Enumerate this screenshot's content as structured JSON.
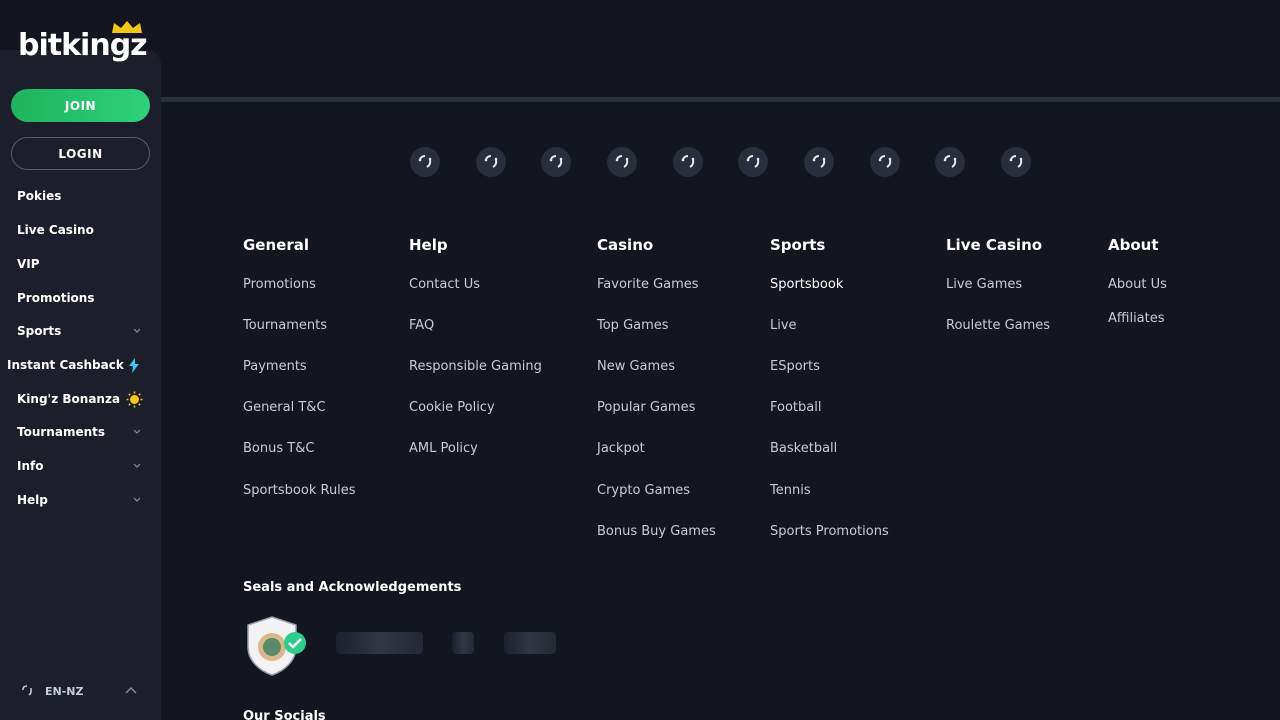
{
  "brand": {
    "logo_text": "bitkingz"
  },
  "sidebar": {
    "join_label": "JOIN",
    "login_label": "LOGIN",
    "items": [
      {
        "label": "Pokies",
        "has_chevron": false
      },
      {
        "label": "Live Casino",
        "has_chevron": false
      },
      {
        "label": "VIP",
        "has_chevron": false
      },
      {
        "label": "Promotions",
        "has_chevron": false
      },
      {
        "label": "Sports",
        "has_chevron": true
      },
      {
        "label": "Instant Cashback",
        "icon": "lightning-icon"
      },
      {
        "label": "King'z Bonanza",
        "icon": "sun-icon"
      },
      {
        "label": "Tournaments",
        "has_chevron": true
      },
      {
        "label": "Info",
        "has_chevron": true
      },
      {
        "label": "Help",
        "has_chevron": true
      }
    ],
    "language": "EN-NZ"
  },
  "providers": {
    "count": 10,
    "icon": "loading-spinner-icon"
  },
  "footer": {
    "columns": [
      {
        "title": "General",
        "links": [
          "Promotions",
          "Tournaments",
          "Payments",
          "General T&C",
          "Bonus T&C",
          "Sportsbook Rules"
        ]
      },
      {
        "title": "Help",
        "links": [
          "Contact Us",
          "FAQ",
          "Responsible Gaming",
          "Cookie Policy",
          "AML Policy"
        ]
      },
      {
        "title": "Casino",
        "links": [
          "Favorite Games",
          "Top Games",
          "New Games",
          "Popular Games",
          "Jackpot",
          "Crypto Games",
          "Bonus Buy Games"
        ]
      },
      {
        "title": "Sports",
        "links": [
          "Sportsbook",
          "Live",
          "ESports",
          "Football",
          "Basketball",
          "Tennis",
          "Sports Promotions"
        ]
      },
      {
        "title": "Live Casino",
        "links": [
          "Live Games",
          "Roulette Games"
        ]
      },
      {
        "title": "About",
        "links": [
          "About Us",
          "Affiliates"
        ]
      }
    ],
    "seals_title": "Seals and Acknowledgements",
    "socials_title": "Our Socials"
  },
  "colors": {
    "background": "#13151f",
    "sidebar": "#1c1e2b",
    "join_green": "#1fb35d"
  }
}
